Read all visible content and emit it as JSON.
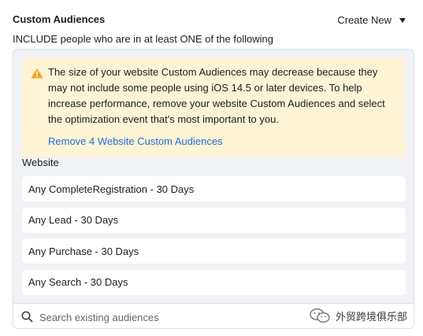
{
  "header": {
    "title": "Custom Audiences",
    "create_new_label": "Create New"
  },
  "include_text": "INCLUDE people who are in at least ONE of the following",
  "warning": {
    "message": "The size of your website Custom Audiences may decrease because they may not include some people using iOS 14.5 or later devices. To help increase performance, remove your website Custom Audiences and select the optimization event that's most important to you.",
    "link_label": "Remove 4 Website Custom Audiences",
    "icon": "warning-triangle-icon",
    "background_color": "#fdf3d5",
    "icon_color": "#f0a81a",
    "link_color": "#216fdb"
  },
  "section_label": "Website",
  "audiences": [
    {
      "label": "Any CompleteRegistration - 30 Days"
    },
    {
      "label": "Any Lead - 30 Days"
    },
    {
      "label": "Any Purchase - 30 Days"
    },
    {
      "label": "Any Search - 30 Days"
    }
  ],
  "search": {
    "placeholder": "Search existing audiences",
    "value": ""
  },
  "watermark": {
    "text": "外贸跨境俱乐部"
  }
}
